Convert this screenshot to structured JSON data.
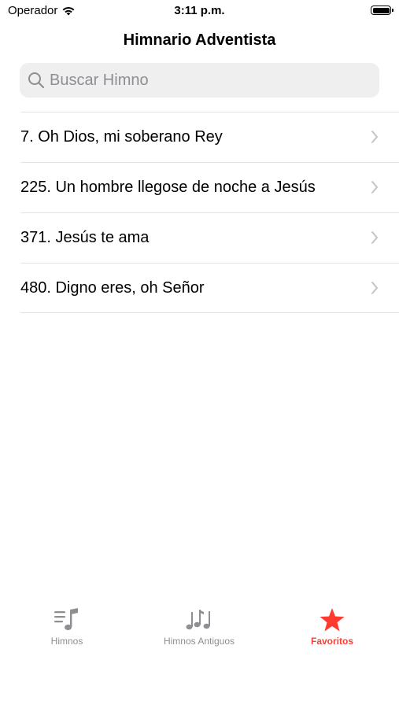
{
  "status_bar": {
    "carrier": "Operador",
    "time": "3:11 p.m."
  },
  "nav": {
    "title": "Himnario Adventista"
  },
  "search": {
    "placeholder": "Buscar Himno",
    "icon": "magnifier"
  },
  "hymns": [
    {
      "label": "7. Oh Dios, mi soberano Rey"
    },
    {
      "label": "225. Un hombre llegose de noche a Jesús"
    },
    {
      "label": "371. Jesús te ama"
    },
    {
      "label": "480. Digno eres, oh Señor"
    }
  ],
  "tabs": [
    {
      "label": "Himnos",
      "icon": "music-list"
    },
    {
      "label": "Himnos Antiguos",
      "icon": "music-notes"
    },
    {
      "label": "Favoritos",
      "icon": "star",
      "active": true
    }
  ],
  "colors": {
    "accent": "#ff3b30",
    "inactive": "#8e8e93",
    "search_bg": "#efeff0",
    "separator": "#e3e3e6"
  }
}
